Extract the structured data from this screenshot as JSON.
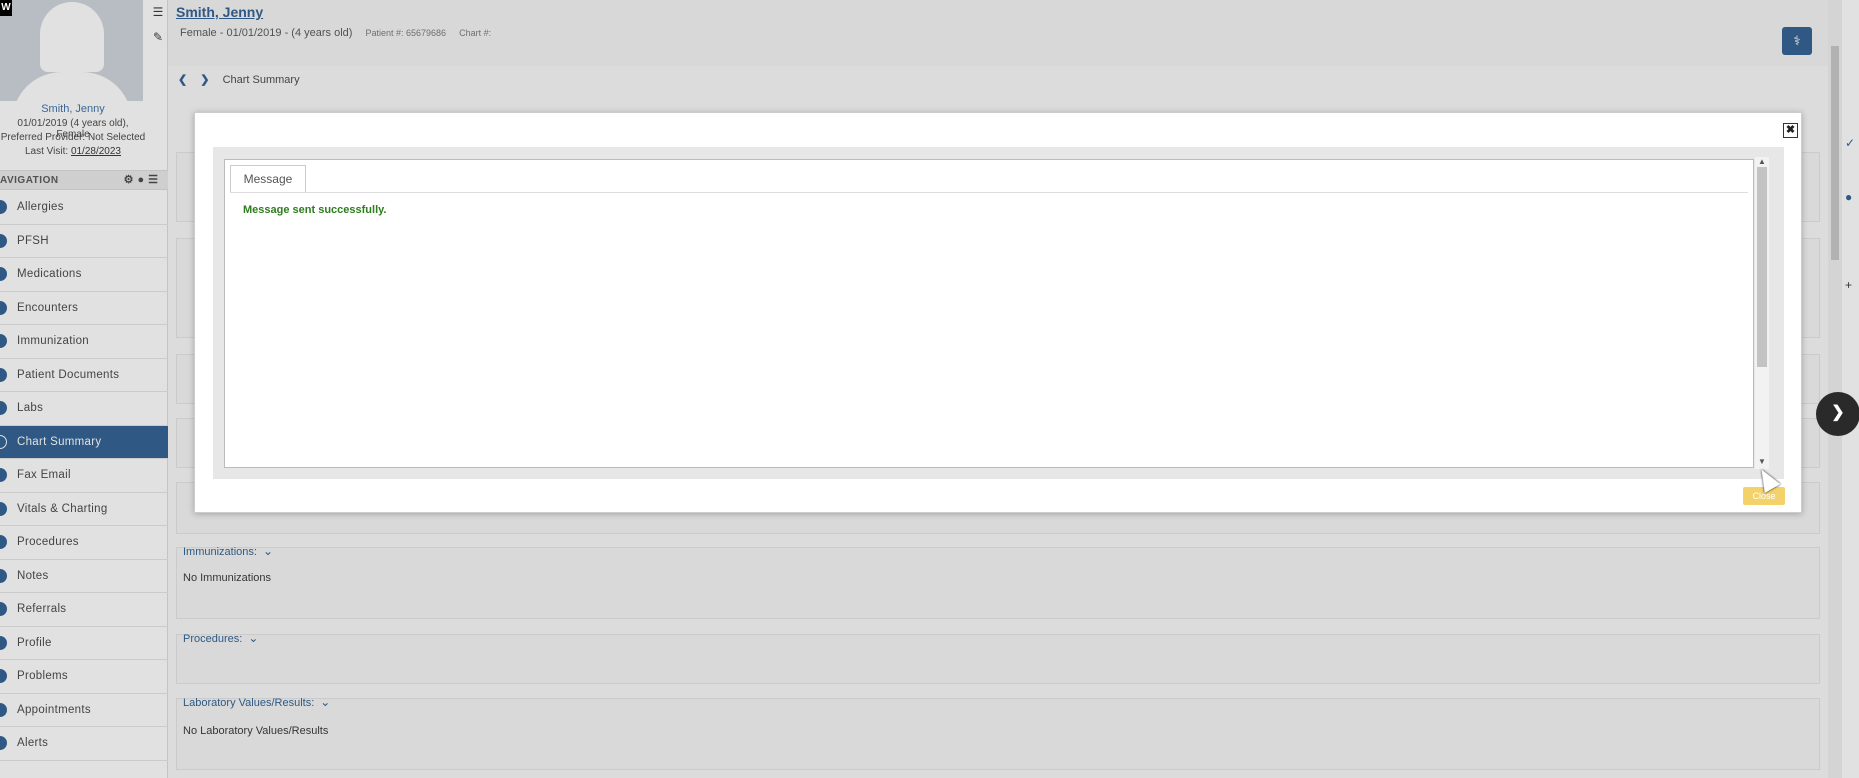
{
  "patient": {
    "name": "Smith, Jenny",
    "subtitle": "Female - 01/01/2019 - (4 years old)",
    "patient_num_label": "Patient #: 65679686",
    "chart_num_label": "Chart #:"
  },
  "sidebar": {
    "name": "Smith, Jenny",
    "info_line1": "01/01/2019 (4 years old), Female",
    "info_line2": "Preferred Provider: Not Selected",
    "last_visit_label": "Last Visit:",
    "last_visit_date": "01/28/2023",
    "nav_header": "AVIGATION",
    "items": [
      {
        "label": "Allergies"
      },
      {
        "label": "PFSH"
      },
      {
        "label": "Medications"
      },
      {
        "label": "Encounters"
      },
      {
        "label": "Immunization"
      },
      {
        "label": "Patient Documents"
      },
      {
        "label": "Labs"
      },
      {
        "label": "Chart Summary"
      },
      {
        "label": "Fax Email"
      },
      {
        "label": "Vitals & Charting"
      },
      {
        "label": "Procedures"
      },
      {
        "label": "Notes"
      },
      {
        "label": "Referrals"
      },
      {
        "label": "Profile"
      },
      {
        "label": "Problems"
      },
      {
        "label": "Appointments"
      },
      {
        "label": "Alerts"
      }
    ],
    "active_item": "Chart Summary"
  },
  "breadcrumb": {
    "current": "Chart Summary"
  },
  "sections": {
    "immunizations_title": "Immunizations:",
    "immunizations_empty": "No Immunizations",
    "procedures_title": "Procedures:",
    "labs_title": "Laboratory Values/Results:",
    "labs_empty": "No Laboratory Values/Results"
  },
  "modal": {
    "tab_label": "Message",
    "message": "Message sent successfully.",
    "close_label": "Close",
    "close_icon": "close-box-icon"
  },
  "colors": {
    "primary": "#2b5d91",
    "success_text": "#2e7d1e",
    "close_button": "#f3d26b"
  }
}
